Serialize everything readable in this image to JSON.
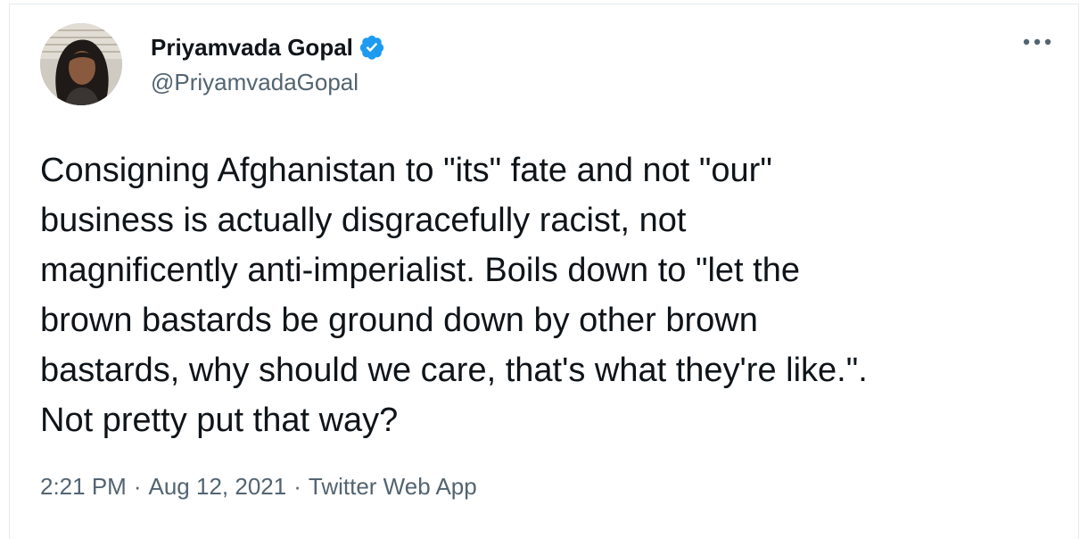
{
  "tweet": {
    "author": {
      "display_name": "Priyamvada Gopal",
      "handle": "@PriyamvadaGopal",
      "verified": true,
      "avatar_icon": "profile-photo"
    },
    "more_icon": "more-horizontal-icon",
    "text": "Consigning Afghanistan to \"its\" fate and not \"our\"\nbusiness is actually disgracefully racist, not\nmagnificently anti-imperialist. Boils down to \"let the\nbrown bastards be ground down by other brown\nbastards, why should we care, that's what they're like.\".\nNot pretty put that way?",
    "meta": {
      "time": "2:21 PM",
      "separator": "·",
      "date": "Aug 12, 2021",
      "source": "Twitter Web App"
    }
  },
  "colors": {
    "text_primary": "#0f1419",
    "text_secondary": "#536471",
    "verified_blue": "#1d9bf0",
    "border": "#e6ecf0"
  }
}
